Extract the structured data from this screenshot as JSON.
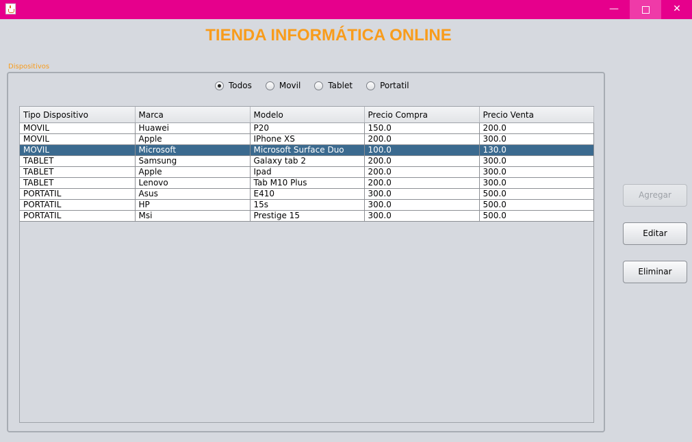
{
  "window": {
    "icon": "java-cup-icon",
    "controls": {
      "minimize": "—",
      "close": "✕"
    }
  },
  "header": {
    "title": "TIENDA INFORMÁTICA ONLINE"
  },
  "group": {
    "title": "Dispositivos"
  },
  "filters": [
    {
      "label": "Todos",
      "checked": true
    },
    {
      "label": "Movil",
      "checked": false
    },
    {
      "label": "Tablet",
      "checked": false
    },
    {
      "label": "Portatil",
      "checked": false
    }
  ],
  "table": {
    "columns": [
      "Tipo Dispositivo",
      "Marca",
      "Modelo",
      "Precio Compra",
      "Precio Venta"
    ],
    "selected_row": 2,
    "rows": [
      [
        "MOVIL",
        "Huawei",
        "P20",
        "150.0",
        "200.0"
      ],
      [
        "MOVIL",
        "Apple",
        "IPhone XS",
        "200.0",
        "300.0"
      ],
      [
        "MOVIL",
        "Microsoft",
        "Microsoft Surface Duo",
        "100.0",
        "130.0"
      ],
      [
        "TABLET",
        "Samsung",
        "Galaxy tab 2",
        "200.0",
        "300.0"
      ],
      [
        "TABLET",
        "Apple",
        "Ipad",
        "200.0",
        "300.0"
      ],
      [
        "TABLET",
        "Lenovo",
        "Tab M10 Plus",
        "200.0",
        "300.0"
      ],
      [
        "PORTATIL",
        "Asus",
        "E410",
        "300.0",
        "500.0"
      ],
      [
        "PORTATIL",
        "HP",
        "15s",
        "300.0",
        "500.0"
      ],
      [
        "PORTATIL",
        "Msi",
        "Prestige 15",
        "300.0",
        "500.0"
      ]
    ]
  },
  "actions": {
    "add_label": "Agregar",
    "add_enabled": false,
    "edit_label": "Editar",
    "delete_label": "Eliminar"
  },
  "colors": {
    "titlebar": "#e6008c",
    "accent": "#f89c1c",
    "selection": "#3b6a8f"
  }
}
